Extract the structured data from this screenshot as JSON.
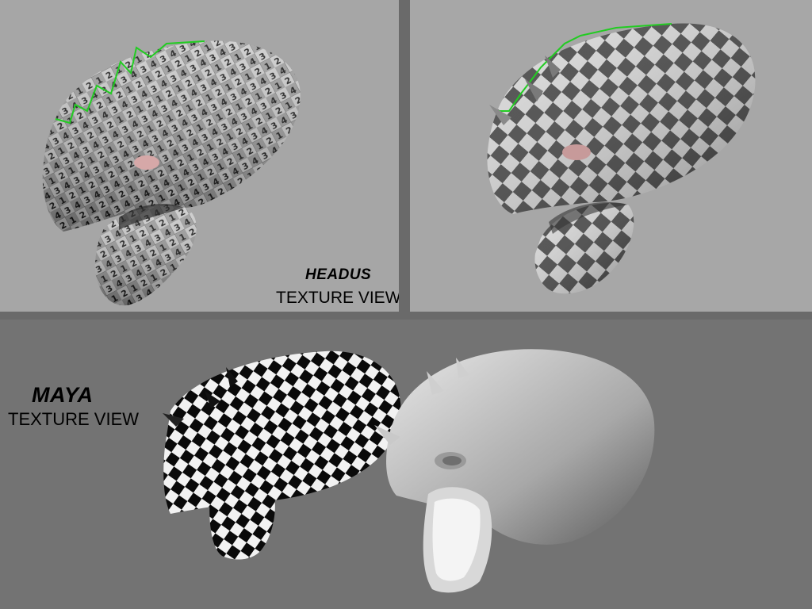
{
  "panels": {
    "headus": {
      "title": "HEADUS",
      "subtitle": "TEXTURE VIEW"
    },
    "maya": {
      "title": "MAYA",
      "subtitle": "TEXTURE VIEW"
    }
  },
  "colors": {
    "viewport_bg": "#a6a6a6",
    "bottom_bg": "#737373",
    "divider": "#6a6a6a",
    "seam_highlight": "#22cc22",
    "checker_dark": "#4a4a4a",
    "checker_light": "#d8d8d8"
  }
}
